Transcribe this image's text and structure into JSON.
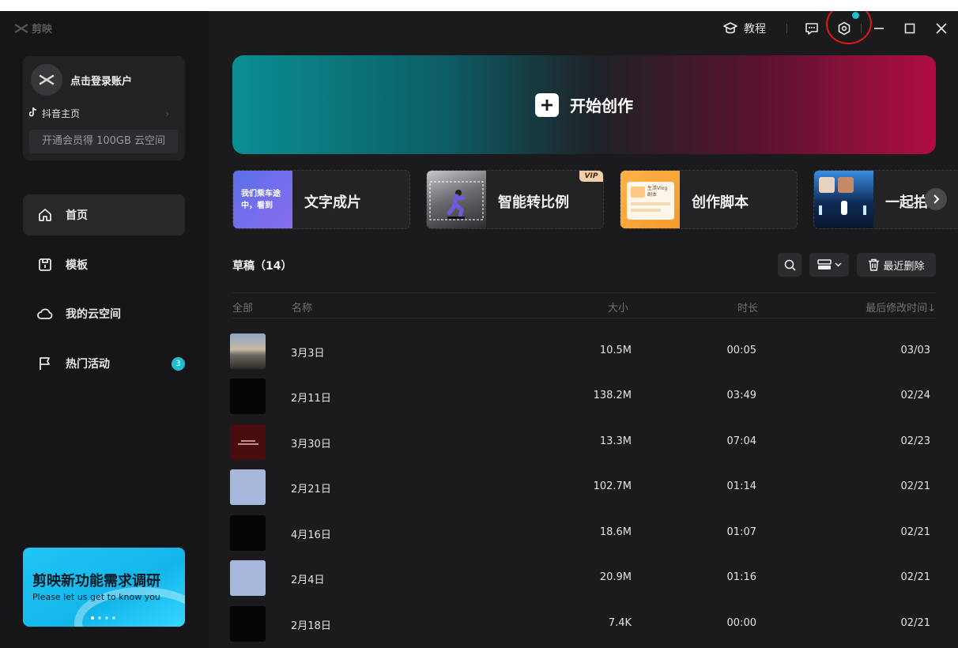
{
  "app": {
    "logo_text": "剪映"
  },
  "titlebar": {
    "tutorial_label": "教程"
  },
  "account": {
    "login_label": "点击登录账户",
    "douyin_label": "抖音主页",
    "vip_promo": "开通会员得 100GB 云空间"
  },
  "nav": {
    "items": [
      {
        "label": "首页",
        "icon": "home-icon",
        "active": true
      },
      {
        "label": "模板",
        "icon": "template-icon",
        "active": false
      },
      {
        "label": "我的云空间",
        "icon": "cloud-icon",
        "active": false
      },
      {
        "label": "热门活动",
        "icon": "flag-icon",
        "active": false,
        "badge": "3"
      }
    ]
  },
  "survey": {
    "title": "剪映新功能需求调研",
    "subtitle": "Please let us get to know you"
  },
  "hero": {
    "label": "开始创作"
  },
  "tools": [
    {
      "label": "文字成片",
      "thumb_text": "我们乘车途中，看到"
    },
    {
      "label": "智能转比例",
      "vip": "VIP"
    },
    {
      "label": "创作脚本",
      "thumb_text": "生活Vlog\n剧本"
    },
    {
      "label": "一起拍"
    }
  ],
  "drafts": {
    "title": "草稿（14）",
    "recent_delete_label": "最近删除",
    "columns": {
      "all": "全部",
      "name": "名称",
      "size": "大小",
      "duration": "时长",
      "modified": "最后修改时间↓"
    },
    "rows": [
      {
        "name": "3月3日",
        "size": "10.5M",
        "duration": "00:05",
        "modified": "03/03",
        "thumb": "sunset"
      },
      {
        "name": "2月11日",
        "size": "138.2M",
        "duration": "03:49",
        "modified": "02/24",
        "thumb": "black"
      },
      {
        "name": "3月30日",
        "size": "13.3M",
        "duration": "07:04",
        "modified": "02/23",
        "thumb": "red"
      },
      {
        "name": "2月21日",
        "size": "102.7M",
        "duration": "01:14",
        "modified": "02/21",
        "thumb": "blue"
      },
      {
        "name": "4月16日",
        "size": "18.6M",
        "duration": "01:07",
        "modified": "02/21",
        "thumb": "black"
      },
      {
        "name": "2月4日",
        "size": "20.9M",
        "duration": "01:16",
        "modified": "02/21",
        "thumb": "blue"
      },
      {
        "name": "2月18日",
        "size": "7.4K",
        "duration": "00:00",
        "modified": "02/21",
        "thumb": "black"
      }
    ]
  },
  "colors": {
    "accent": "#1fbfd0",
    "annotation": "#e01818"
  }
}
